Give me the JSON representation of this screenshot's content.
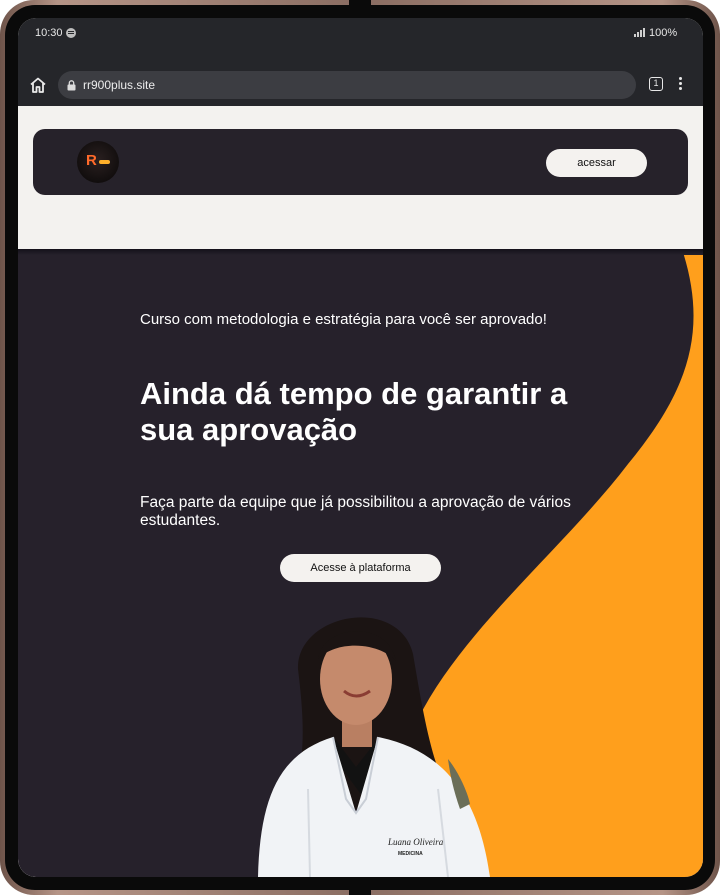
{
  "status_bar": {
    "time": "10:30",
    "battery": "100%"
  },
  "browser": {
    "url": "rr900plus.site",
    "tab_count": "1"
  },
  "site_header": {
    "logo_text": "R",
    "access_button": "acessar"
  },
  "hero": {
    "eyebrow": "Curso com metodologia e estratégia para você ser aprovado!",
    "headline": "Ainda dá tempo de garantir a sua aprovação",
    "subtext": "Faça parte da equipe que já possibilitou a aprovação de vários estudantes.",
    "cta_button": "Acesse à plataforma",
    "coat_name": "Luana Oliveira",
    "coat_title": "MEDICINA"
  },
  "colors": {
    "hero_bg": "#26212b",
    "accent_orange": "#ff9f1c",
    "browser_chrome": "#25262a"
  }
}
